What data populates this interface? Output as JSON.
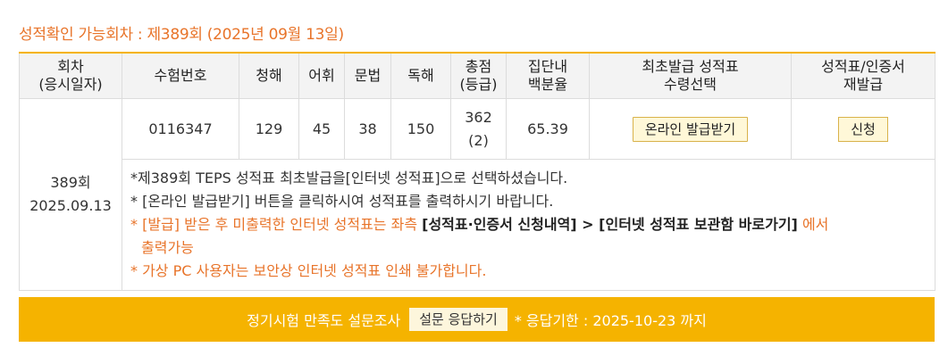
{
  "available": {
    "text": "성적확인 가능회차 : 제389회 (2025년 09월 13일)"
  },
  "table": {
    "headers": {
      "round": "회차",
      "round_sub": "(응시일자)",
      "exam_no": "수험번호",
      "listening": "청해",
      "vocab": "어휘",
      "grammar": "문법",
      "reading": "독해",
      "total": "총점",
      "total_sub": "(등급)",
      "percentile": "집단내",
      "percentile_sub": "백분율",
      "first_issue": "최초발급 성적표",
      "first_issue_sub": "수령선택",
      "reissue": "성적표/인증서",
      "reissue_sub": "재발급"
    },
    "row": {
      "round": "389회",
      "date": "2025.09.13",
      "exam_no": "0116347",
      "listening": "129",
      "vocab": "45",
      "grammar": "38",
      "reading": "150",
      "total": "362",
      "grade": "(2)",
      "percentile": "65.39",
      "issue_button": "온라인 발급받기",
      "reissue_button": "신청"
    },
    "notes": {
      "line1": "*제389회 TEPS 성적표 최초발급을[인터넷 성적표]으로 선택하셨습니다.",
      "line2": "* [온라인 발급받기] 버튼을 클릭하시여 성적표를 출력하시기 바랍니다.",
      "line3_a": "* [발급] 받은 후 미출력한 인터넷 성적표는 좌측 ",
      "line3_b": "[성적표·인증서 신청내역] > [인터넷 성적표 보관함 바로가기]",
      "line3_c": " 에서",
      "line4": "출력가능",
      "line5": "* 가상 PC 사용자는 보안상 인터넷 성적표 인쇄 불가합니다."
    }
  },
  "survey": {
    "label": "정기시험 만족도 설문조사",
    "button": "설문 응답하기",
    "deadline": "* 응답기한 : 2025-10-23 까지"
  },
  "colors": {
    "accent": "#f5b300",
    "orange_text": "#e8742a"
  }
}
